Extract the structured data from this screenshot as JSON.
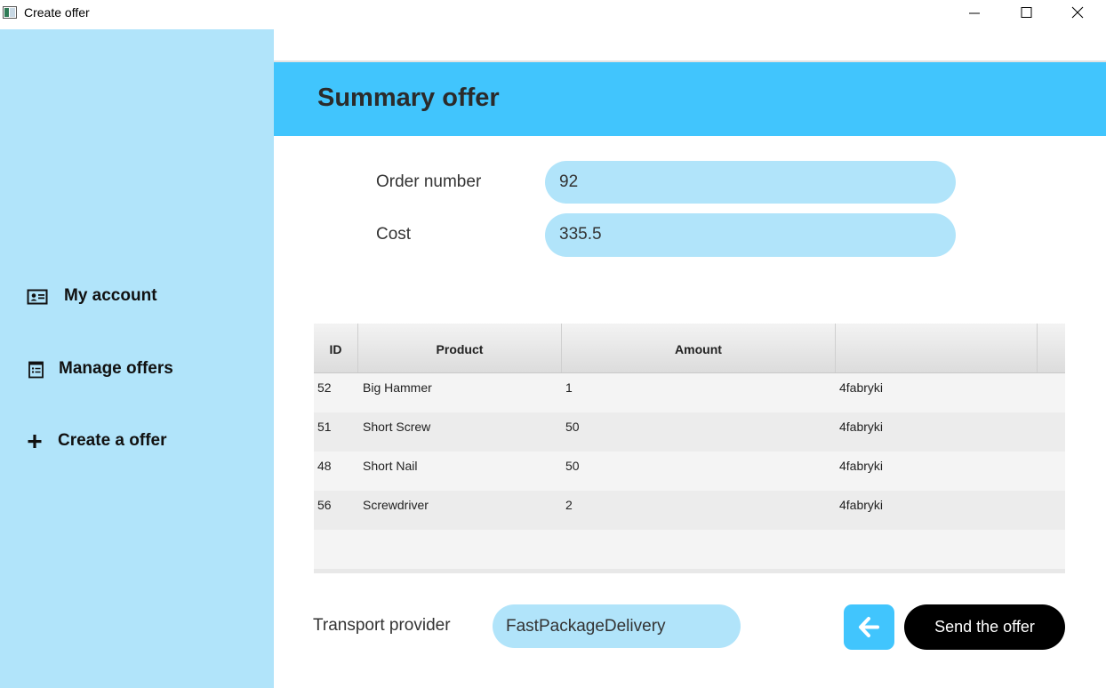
{
  "window": {
    "title": "Create offer"
  },
  "sidebar": {
    "items": [
      {
        "label": "My account",
        "icon": "account-card-icon"
      },
      {
        "label": "Manage offers",
        "icon": "list-icon"
      },
      {
        "label": "Create a offer",
        "icon": "plus-icon"
      }
    ]
  },
  "header": {
    "title": "Summary offer"
  },
  "form": {
    "order_number_label": "Order number",
    "order_number_value": "92",
    "cost_label": "Cost",
    "cost_value": "335.5"
  },
  "table": {
    "columns": [
      "ID",
      "Product",
      "Amount",
      ""
    ],
    "rows": [
      {
        "id": "52",
        "product": "Big Hammer",
        "amount": "1",
        "extra": "4fabryki"
      },
      {
        "id": "51",
        "product": "Short Screw",
        "amount": "50",
        "extra": "4fabryki"
      },
      {
        "id": "48",
        "product": "Short Nail",
        "amount": "50",
        "extra": "4fabryki"
      },
      {
        "id": "56",
        "product": "Screwdriver",
        "amount": "2",
        "extra": "4fabryki"
      }
    ]
  },
  "transport": {
    "label": "Transport provider",
    "value": "FastPackageDelivery"
  },
  "actions": {
    "back_icon": "arrow-left-icon",
    "send_label": "Send the offer"
  },
  "colors": {
    "accent": "#41c5fd",
    "sidebar": "#b1e4fa",
    "field": "#b1e4fa",
    "send_button": "#000000"
  }
}
